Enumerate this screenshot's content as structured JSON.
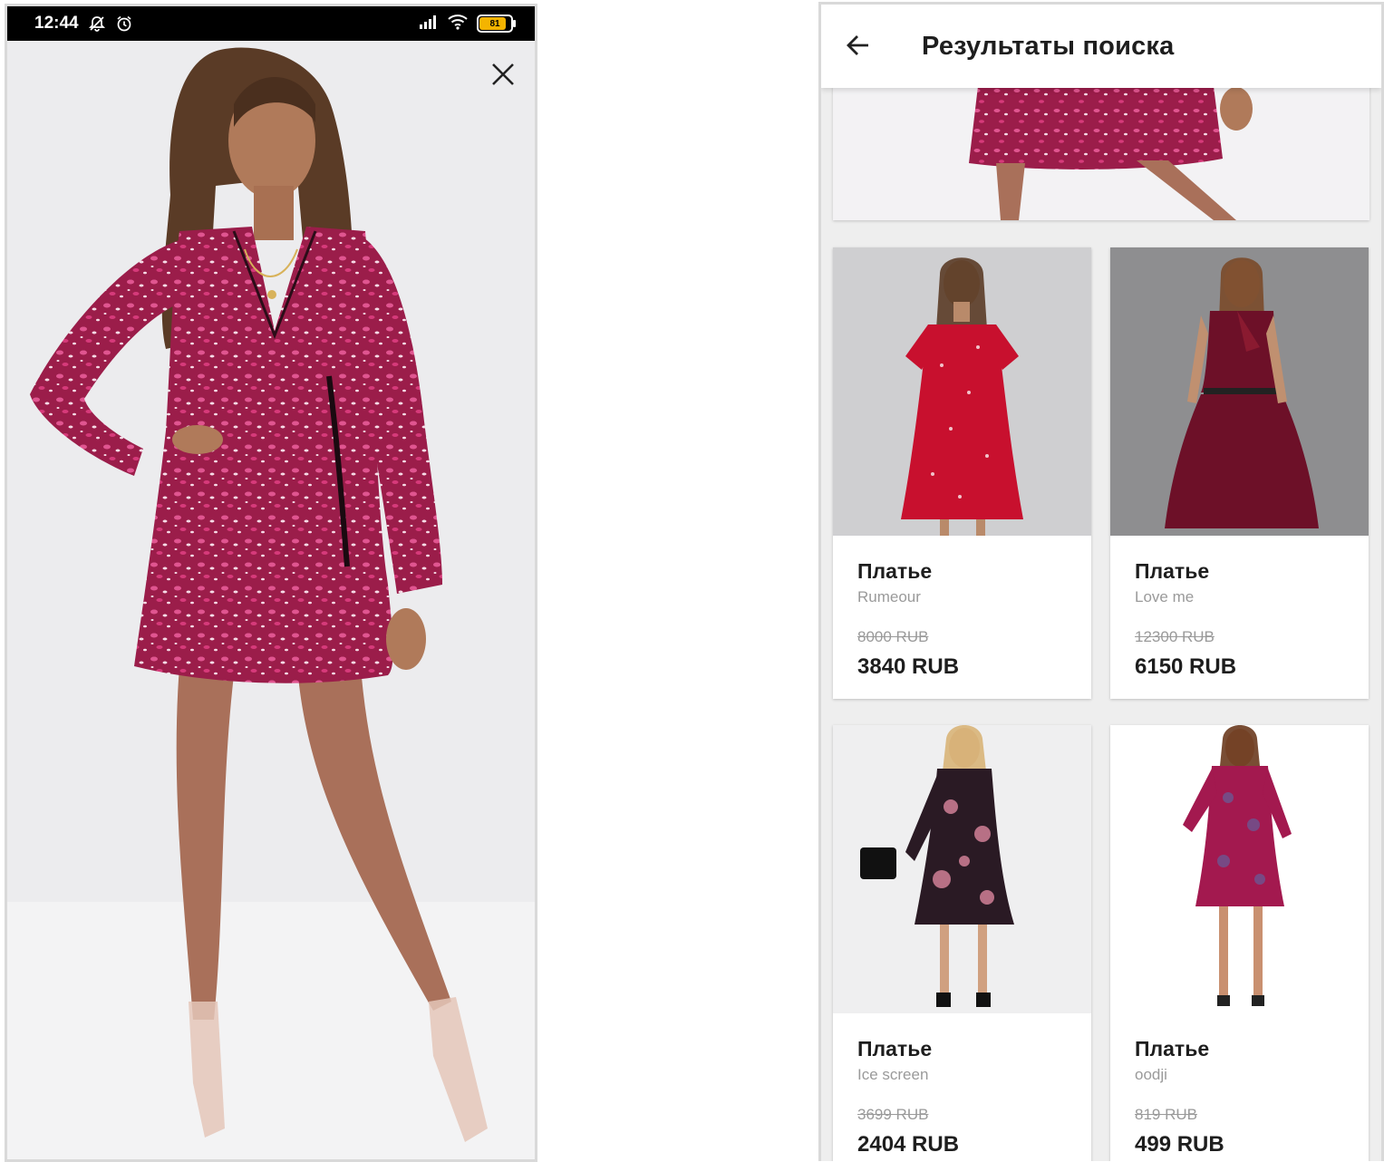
{
  "status_bar": {
    "time": "12:44",
    "battery": "81",
    "battery_level": 0.81
  },
  "left_screen": {
    "close_icon": "close-icon"
  },
  "results": {
    "title": "Результаты поиска",
    "back_icon": "arrow-left-icon",
    "products": [
      {
        "name": "Платье",
        "brand": "Rumeour",
        "old_price": "8000 RUB",
        "price": "3840 RUB",
        "dress_color": "#c8102e"
      },
      {
        "name": "Платье",
        "brand": "Love me",
        "old_price": "12300 RUB",
        "price": "6150 RUB",
        "dress_color": "#6d1028"
      },
      {
        "name": "Платье",
        "brand": "Ice screen",
        "old_price": "3699 RUB",
        "price": "2404 RUB",
        "dress_color": "#2a1a24"
      },
      {
        "name": "Платье",
        "brand": "oodji",
        "old_price": "819 RUB",
        "price": "499 RUB",
        "dress_color": "#a3194f"
      }
    ]
  },
  "colors": {
    "accent_dress": "#9b1d4a",
    "text_dark": "#1e1e1e",
    "text_muted": "#9a9a9a"
  }
}
